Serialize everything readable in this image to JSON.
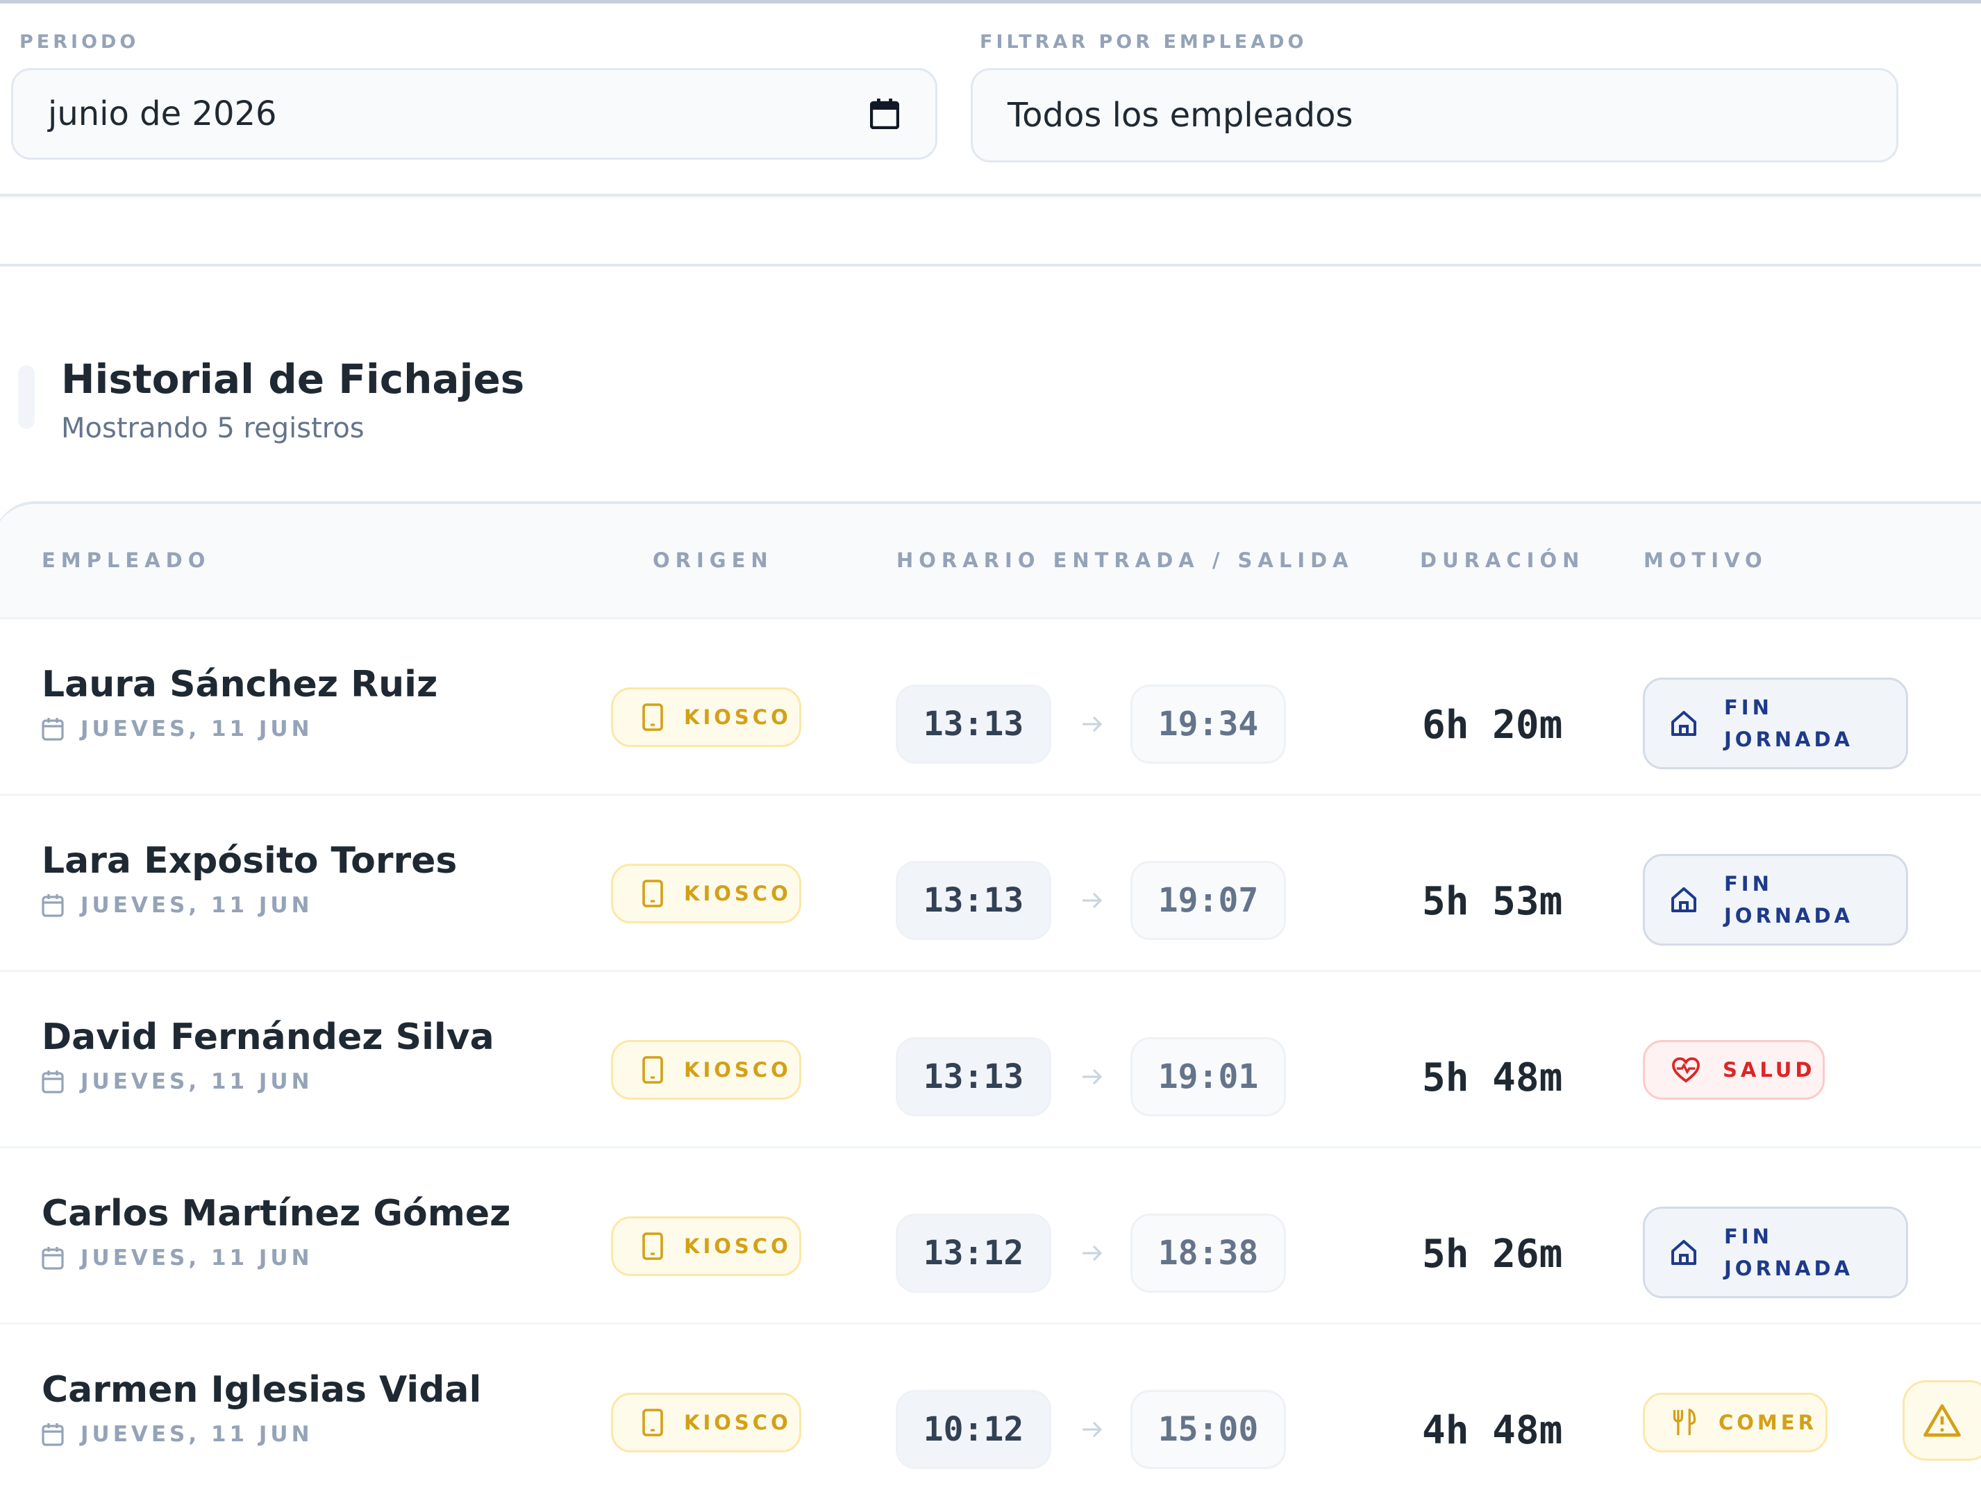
{
  "filters": {
    "periodo": {
      "label": "PERIODO",
      "value": "junio de 2026",
      "icon": "calendar-icon"
    },
    "empleado": {
      "label": "FILTRAR POR EMPLEADO",
      "value": "Todos los empleados"
    }
  },
  "header": {
    "title": "Historial de Fichajes",
    "subtitle": "Mostrando 5 registros"
  },
  "table": {
    "columns": [
      "EMPLEADO",
      "ORIGEN",
      "HORARIO ENTRADA / SALIDA",
      "DURACIÓN",
      "MOTIVO"
    ],
    "rows": [
      {
        "name": "Laura Sánchez Ruiz",
        "date": "JUEVES, 11 JUN",
        "origen": "KIOSCO",
        "entrada": "13:13",
        "salida": "19:34",
        "duracion": "6h 20m",
        "motivo_line1": "FIN",
        "motivo_line2": "JORNADA",
        "motivo_icon": "home-icon"
      },
      {
        "name": "Lara Expósito Torres",
        "date": "JUEVES, 11 JUN",
        "origen": "KIOSCO",
        "entrada": "13:13",
        "salida": "19:07",
        "duracion": "5h 53m",
        "motivo_line1": "FIN",
        "motivo_line2": "JORNADA",
        "motivo_icon": "home-icon"
      },
      {
        "name": "David Fernández Silva",
        "date": "JUEVES, 11 JUN",
        "origen": "KIOSCO",
        "entrada": "13:13",
        "salida": "19:01",
        "duracion": "5h 48m",
        "motivo": "SALUD",
        "motivo_icon": "heart-pulse-icon"
      },
      {
        "name": "Carlos Martínez Gómez",
        "date": "JUEVES, 11 JUN",
        "origen": "KIOSCO",
        "entrada": "13:12",
        "salida": "18:38",
        "duracion": "5h 26m",
        "motivo_line1": "FIN",
        "motivo_line2": "JORNADA",
        "motivo_icon": "home-icon"
      },
      {
        "name": "Carmen Iglesias Vidal",
        "date": "JUEVES, 11 JUN",
        "origen": "KIOSCO",
        "entrada": "10:12",
        "salida": "15:00",
        "duracion": "4h 48m",
        "motivo": "COMER",
        "motivo_icon": "utensils-icon",
        "warning_icon": "alert-triangle-icon"
      }
    ]
  },
  "colors": {
    "kiosco": "#d4a017",
    "fin_jornada": "#1e3a8a",
    "salud": "#dc2626",
    "comer": "#d4a017",
    "muted": "#94a3b8"
  }
}
